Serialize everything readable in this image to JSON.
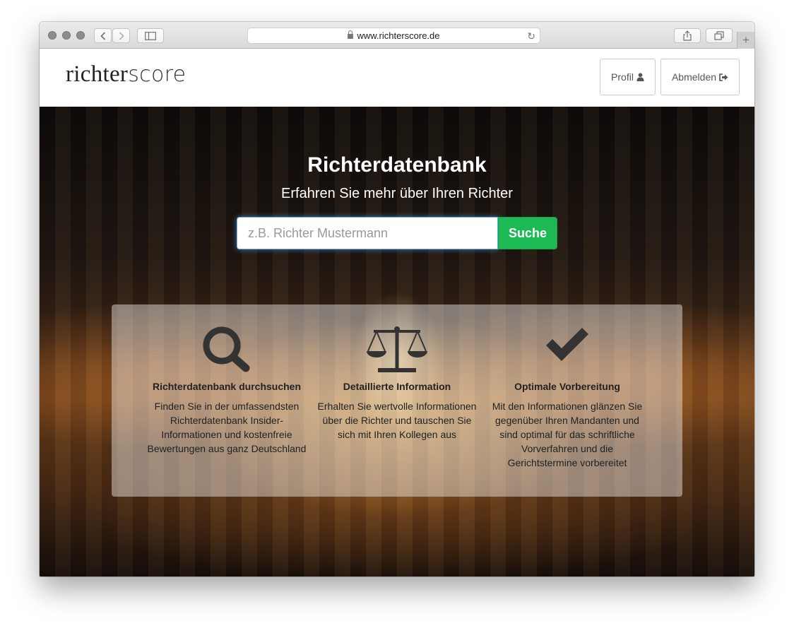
{
  "browser": {
    "url": "www.richterscore.de",
    "icons": [
      "back-icon",
      "forward-icon",
      "sidebar-icon",
      "lock-icon",
      "reload-icon",
      "share-icon",
      "tabs-icon",
      "new-tab-icon"
    ]
  },
  "header": {
    "logo_bold": "richter",
    "logo_light": "score",
    "profile_label": "Profil",
    "logout_label": "Abmelden"
  },
  "hero": {
    "title": "Richterdatenbank",
    "subtitle": "Erfahren Sie mehr über Ihren Richter",
    "search_placeholder": "z.B. Richter Mustermann",
    "search_value": "",
    "search_button": "Suche"
  },
  "features": [
    {
      "icon": "search-icon",
      "title": "Richterdatenbank durchsuchen",
      "text": "Finden Sie in der umfassendsten Richterdatenbank Insider-Informationen und kostenfreie Bewertungen aus ganz Deutschland"
    },
    {
      "icon": "scales-icon",
      "title": "Detaillierte Information",
      "text": "Erhalten Sie wertvolle Informationen über die Richter und tauschen Sie sich mit Ihren Kollegen aus"
    },
    {
      "icon": "checkmark-icon",
      "title": "Optimale Vorbereitung",
      "text": "Mit den Informationen glänzen Sie gegenüber Ihren Mandanten und sind optimal für das schriftliche Vorverfahren und die Gerichtstermine vorbereitet"
    }
  ],
  "colors": {
    "accent_green": "#1db955",
    "focus_blue": "#66afe9"
  }
}
